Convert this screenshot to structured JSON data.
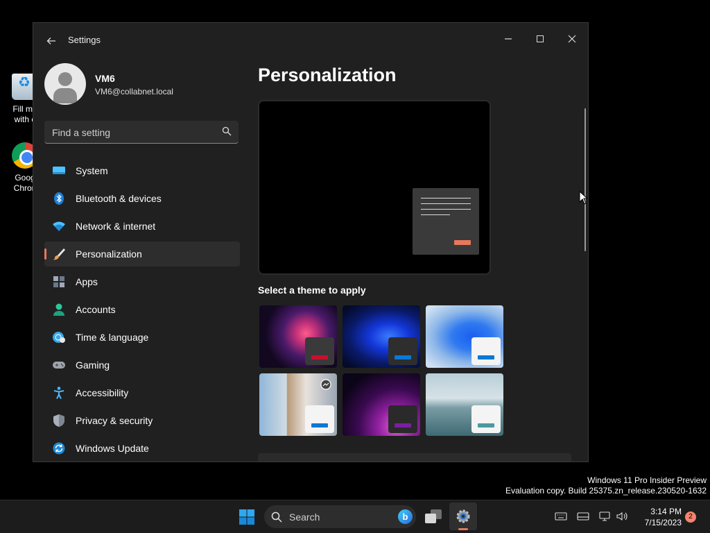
{
  "desktop": {
    "icons": [
      {
        "label_line1": "Fill me",
        "label_line2": "with c",
        "icon": "recycle-bin-icon"
      },
      {
        "label_line1": "Goog",
        "label_line2": "Chron",
        "icon": "chrome-icon"
      }
    ]
  },
  "window": {
    "title": "Settings",
    "controls": {
      "minimize": "minimize-icon",
      "maximize": "maximize-icon",
      "close": "close-icon"
    }
  },
  "profile": {
    "name": "VM6",
    "email": "VM6@collabnet.local"
  },
  "search": {
    "placeholder": "Find a setting"
  },
  "nav": {
    "items": [
      {
        "label": "System",
        "icon": "monitor-icon",
        "active": false
      },
      {
        "label": "Bluetooth & devices",
        "icon": "bluetooth-icon",
        "active": false
      },
      {
        "label": "Network & internet",
        "icon": "wifi-icon",
        "active": false
      },
      {
        "label": "Personalization",
        "icon": "paintbrush-icon",
        "active": true
      },
      {
        "label": "Apps",
        "icon": "apps-icon",
        "active": false
      },
      {
        "label": "Accounts",
        "icon": "person-icon",
        "active": false
      },
      {
        "label": "Time & language",
        "icon": "globe-clock-icon",
        "active": false
      },
      {
        "label": "Gaming",
        "icon": "gamepad-icon",
        "active": false
      },
      {
        "label": "Accessibility",
        "icon": "accessibility-icon",
        "active": false
      },
      {
        "label": "Privacy & security",
        "icon": "shield-icon",
        "active": false
      },
      {
        "label": "Windows Update",
        "icon": "update-icon",
        "active": false
      }
    ]
  },
  "content": {
    "title": "Personalization",
    "theme_section_label": "Select a theme to apply",
    "themes": [
      {
        "name": "flower-dark",
        "accent": "#c8102e"
      },
      {
        "name": "bloom-dark",
        "accent": "#0a78d4"
      },
      {
        "name": "bloom-light",
        "accent": "#0a78d4"
      },
      {
        "name": "spotlight",
        "accent": "#0a78d4"
      },
      {
        "name": "glow",
        "accent": "#7a1fa2"
      },
      {
        "name": "sea",
        "accent": "#4b9aa0"
      }
    ]
  },
  "accent_color": "#e8785c",
  "watermark": {
    "line1": "Windows 11 Pro Insider Preview",
    "line2": "Evaluation copy. Build 25375.zn_release.230520-1632"
  },
  "taskbar": {
    "search_label": "Search",
    "bing_letter": "b",
    "time": "3:14 PM",
    "date": "7/15/2023",
    "notification_count": "2"
  }
}
